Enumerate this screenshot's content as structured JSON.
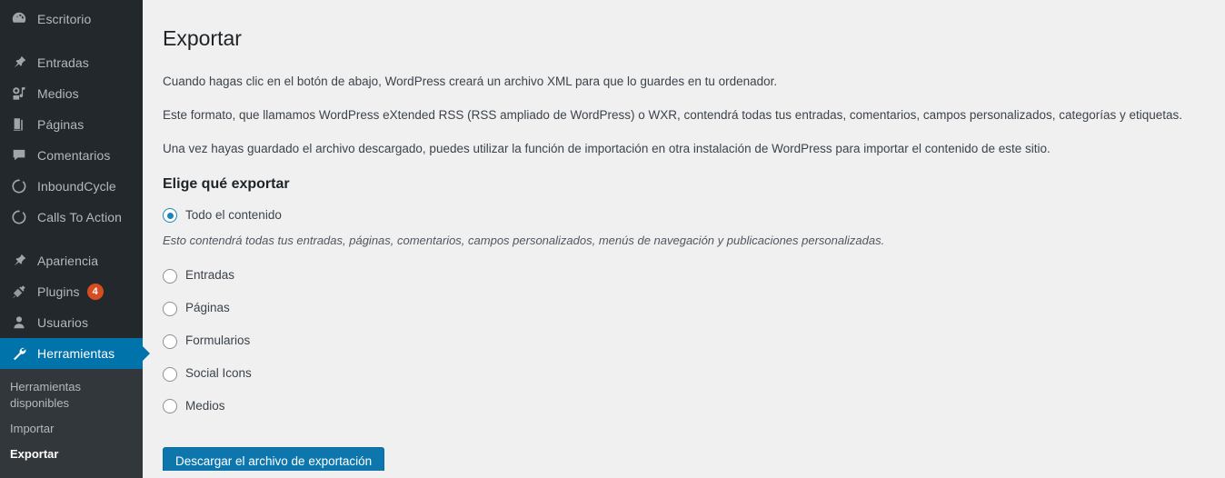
{
  "sidebar": {
    "items": [
      {
        "label": "Escritorio",
        "icon": "dashboard-icon",
        "active": false,
        "badge": null
      },
      {
        "label": "Entradas",
        "icon": "pin-icon",
        "active": false,
        "badge": null
      },
      {
        "label": "Medios",
        "icon": "media-icon",
        "active": false,
        "badge": null
      },
      {
        "label": "Páginas",
        "icon": "pages-icon",
        "active": false,
        "badge": null
      },
      {
        "label": "Comentarios",
        "icon": "comments-icon",
        "active": false,
        "badge": null
      },
      {
        "label": "InboundCycle",
        "icon": "circle-spinner-icon",
        "active": false,
        "badge": null
      },
      {
        "label": "Calls To Action",
        "icon": "circle-spinner-icon",
        "active": false,
        "badge": null
      },
      {
        "label": "Apariencia",
        "icon": "appearance-brush-icon",
        "active": false,
        "badge": null
      },
      {
        "label": "Plugins",
        "icon": "plug-icon",
        "active": false,
        "badge": "4"
      },
      {
        "label": "Usuarios",
        "icon": "user-icon",
        "active": false,
        "badge": null
      },
      {
        "label": "Herramientas",
        "icon": "wrench-icon",
        "active": true,
        "badge": null
      }
    ],
    "submenu": [
      {
        "label": "Herramientas disponibles",
        "current": false
      },
      {
        "label": "Importar",
        "current": false
      },
      {
        "label": "Exportar",
        "current": true
      }
    ]
  },
  "main": {
    "title": "Exportar",
    "paragraphs": [
      "Cuando hagas clic en el botón de abajo, WordPress creará un archivo XML para que lo guardes en tu ordenador.",
      "Este formato, que llamamos WordPress eXtended RSS (RSS ampliado de WordPress) o WXR, contendrá todas tus entradas, comentarios, campos personalizados, categorías y etiquetas.",
      "Una vez hayas guardado el archivo descargado, puedes utilizar la función de importación en otra instalación de WordPress para importar el contenido de este sitio."
    ],
    "section_title": "Elige qué exportar",
    "all_content": {
      "label": "Todo el contenido",
      "selected": true,
      "description": "Esto contendrá todas tus entradas, páginas, comentarios, campos personalizados, menús de navegación y publicaciones personalizadas."
    },
    "options": [
      {
        "label": "Entradas",
        "selected": false
      },
      {
        "label": "Páginas",
        "selected": false
      },
      {
        "label": "Formularios",
        "selected": false
      },
      {
        "label": "Social Icons",
        "selected": false
      },
      {
        "label": "Medios",
        "selected": false
      }
    ],
    "download_button": "Descargar el archivo de exportación"
  },
  "colors": {
    "sidebar_bg": "#23282d",
    "submenu_bg": "#32373c",
    "active_item": "#0073aa",
    "badge": "#d54e21",
    "button": "#0d77ad",
    "radio_accent": "#1a87b8",
    "content_bg": "#f0f0f1"
  }
}
